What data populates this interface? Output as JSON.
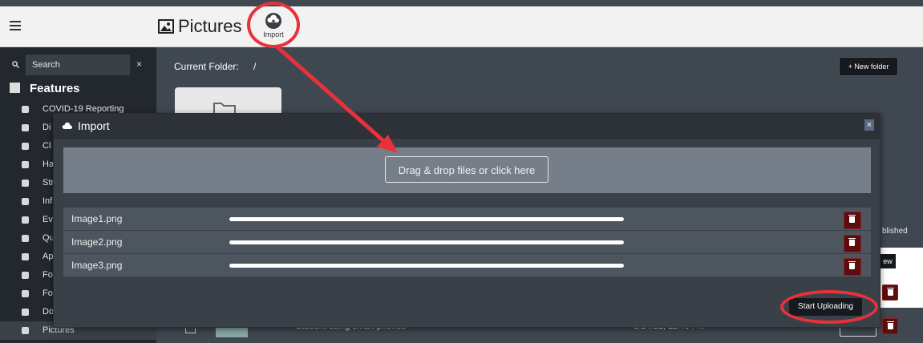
{
  "topbar": {
    "title": "Pictures",
    "import_label": "Import"
  },
  "sidebar": {
    "search_placeholder": "Search",
    "clear_glyph": "×",
    "features_label": "Features",
    "items": [
      {
        "label": "COVID-19 Reporting",
        "icon": "thermometer-icon"
      },
      {
        "label": "Di",
        "icon": "users-icon"
      },
      {
        "label": "Cl",
        "icon": "group-icon"
      },
      {
        "label": "Ha",
        "icon": "stopwatch-icon"
      },
      {
        "label": "Str",
        "icon": "bell-icon"
      },
      {
        "label": "Inf",
        "icon": "info-icon"
      },
      {
        "label": "Ev",
        "icon": "calendar-icon"
      },
      {
        "label": "Qu",
        "icon": "link-icon"
      },
      {
        "label": "Ap",
        "icon": "grid-icon"
      },
      {
        "label": "Fo",
        "icon": "clipboard-icon"
      },
      {
        "label": "Fo",
        "icon": "form-icon"
      },
      {
        "label": "Do",
        "icon": "document-icon"
      },
      {
        "label": "Pictures",
        "icon": "image-icon",
        "active": true
      }
    ]
  },
  "main": {
    "current_folder_label": "Current Folder:",
    "current_folder_path": "/",
    "new_folder_label": "+ New folder",
    "published_fragment": "blished",
    "view_fragment": "ew",
    "bg_row_title": "Student using smart phones",
    "bg_row_date": "3/24/21, 11:46 PM"
  },
  "modal": {
    "title": "Import",
    "close_glyph": "×",
    "dropzone_label": "Drag & drop files or click here",
    "files": [
      {
        "name": "Image1.png",
        "progress": 1.0
      },
      {
        "name": "Image2.png",
        "progress": 1.0
      },
      {
        "name": "Image3.png",
        "progress": 1.0
      }
    ],
    "start_label": "Start Uploading"
  },
  "colors": {
    "callout": "#e8313b",
    "delete_button": "#5a0e0e",
    "topbar": "#f2f2f2"
  }
}
